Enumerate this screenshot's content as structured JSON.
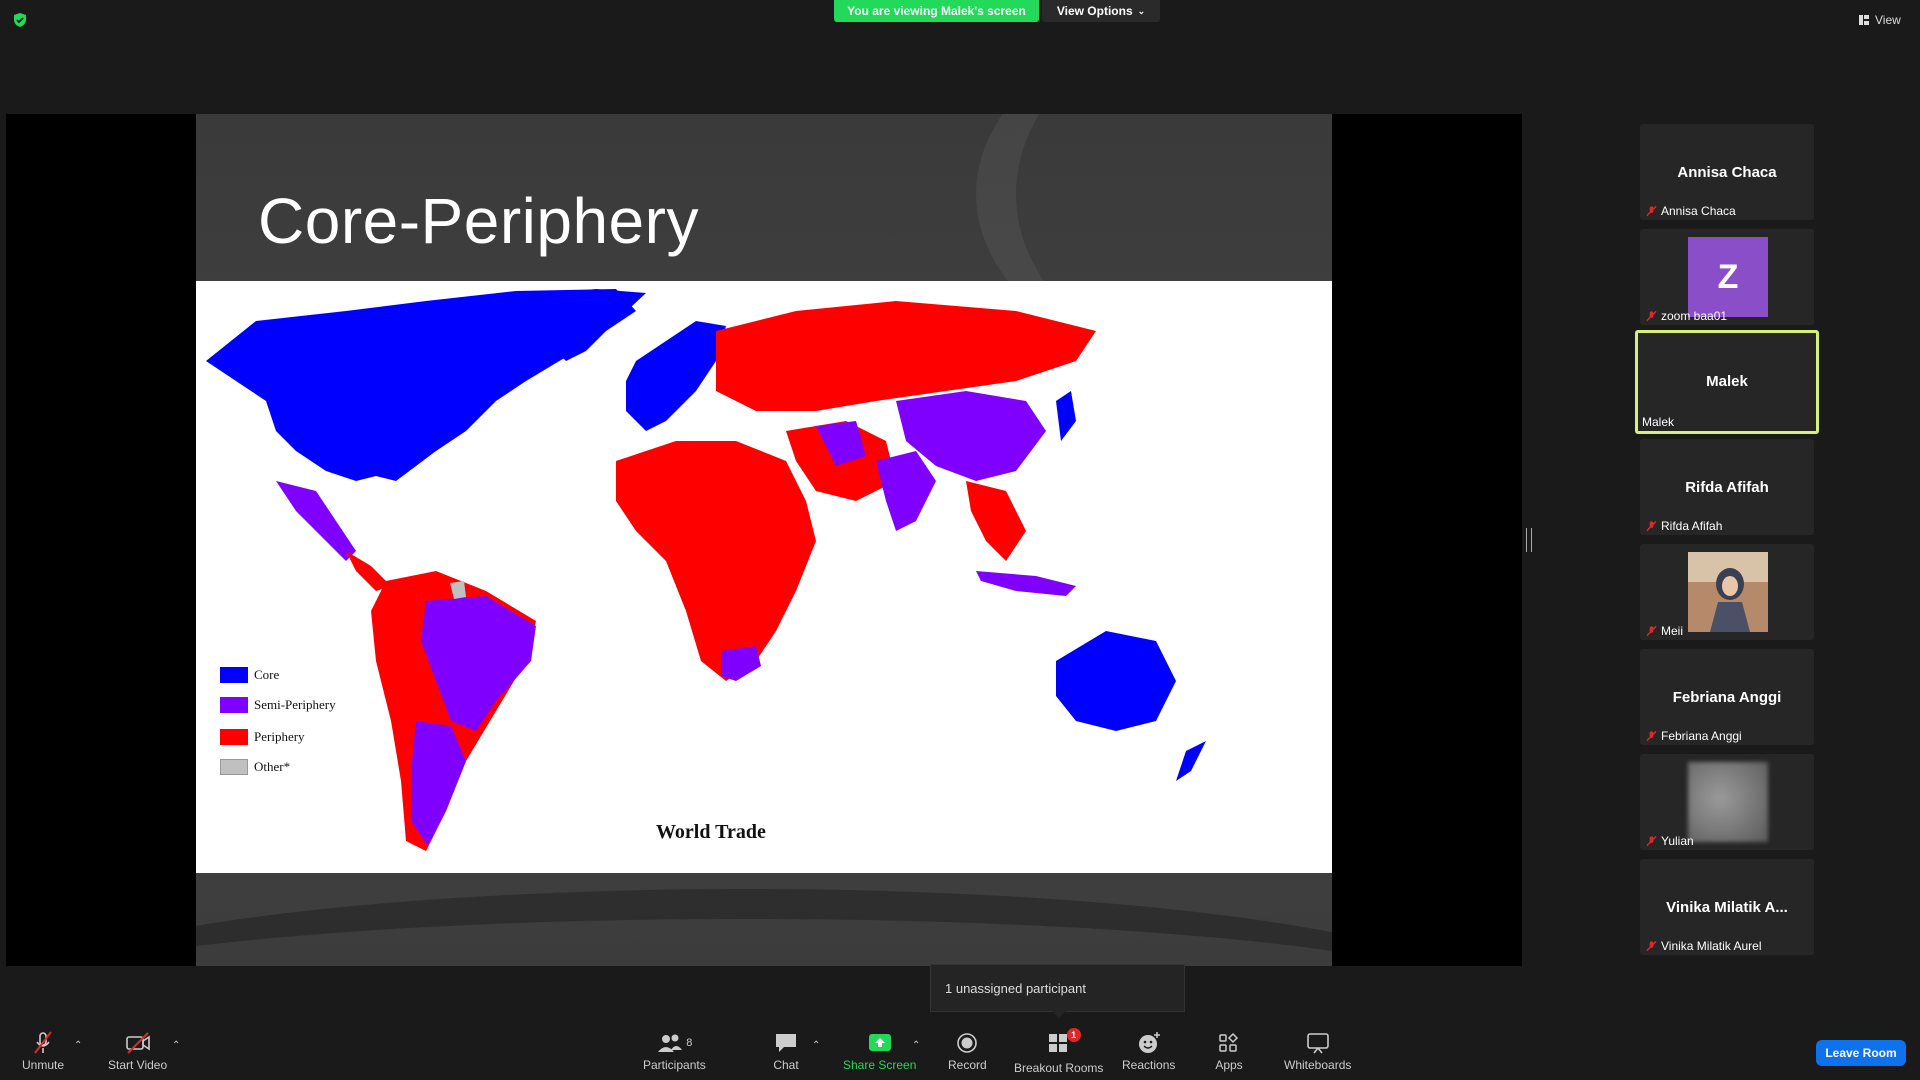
{
  "top": {
    "banner": "You are viewing Malek's screen",
    "view_options": "View Options",
    "view": "View"
  },
  "slide": {
    "title": "Core-Periphery",
    "map_caption": "World Trade",
    "legend": [
      {
        "label": "Core",
        "color": "#0000ff"
      },
      {
        "label": "Semi-Periphery",
        "color": "#8000ff"
      },
      {
        "label": "Periphery",
        "color": "#ff0000"
      },
      {
        "label": "Other*",
        "color": "#c0c0c0"
      }
    ]
  },
  "participants": [
    {
      "display": "Annisa Chaca",
      "label": "Annisa Chaca"
    },
    {
      "display": "Z",
      "label": "zoom baa01"
    },
    {
      "display": "Malek",
      "label": "Malek"
    },
    {
      "display": "Rifda Afifah",
      "label": "Rifda Afifah"
    },
    {
      "display": "",
      "label": "Meii"
    },
    {
      "display": "Febriana Anggi",
      "label": "Febriana Anggi"
    },
    {
      "display": "",
      "label": "Yulian"
    },
    {
      "display": "Vinika Milatik A...",
      "label": "Vinika Milatik Aurel"
    }
  ],
  "tooltip": "1 unassigned participant",
  "toolbar": {
    "unmute": "Unmute",
    "start_video": "Start Video",
    "participants": "Participants",
    "participants_count": "8",
    "chat": "Chat",
    "share_screen": "Share Screen",
    "record": "Record",
    "breakout_rooms": "Breakout Rooms",
    "breakout_badge": "1",
    "reactions": "Reactions",
    "apps": "Apps",
    "whiteboards": "Whiteboards",
    "leave_room": "Leave Room"
  },
  "colors": {
    "share_green": "#23d959",
    "leave_blue": "#0e72ed",
    "active_border": "#d6f07a",
    "mute_red": "#e02828"
  }
}
